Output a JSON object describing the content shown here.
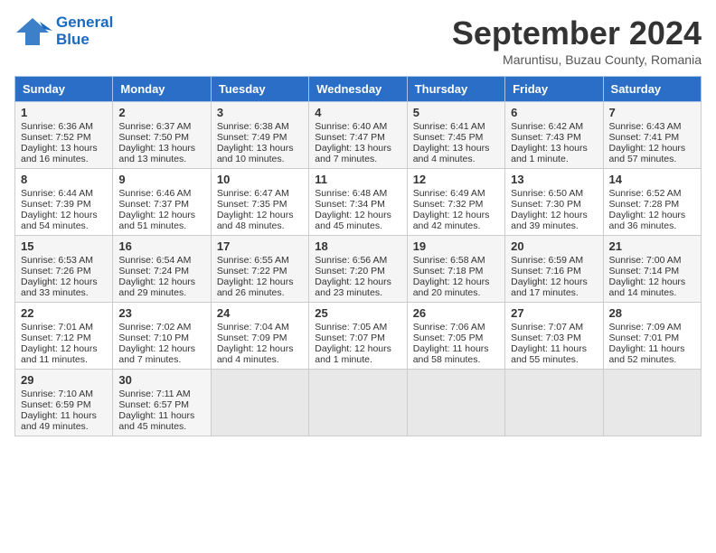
{
  "header": {
    "logo_line1": "General",
    "logo_line2": "Blue",
    "month": "September 2024",
    "location": "Maruntisu, Buzau County, Romania"
  },
  "weekdays": [
    "Sunday",
    "Monday",
    "Tuesday",
    "Wednesday",
    "Thursday",
    "Friday",
    "Saturday"
  ],
  "weeks": [
    [
      {
        "day": "1",
        "lines": [
          "Sunrise: 6:36 AM",
          "Sunset: 7:52 PM",
          "Daylight: 13 hours",
          "and 16 minutes."
        ]
      },
      {
        "day": "2",
        "lines": [
          "Sunrise: 6:37 AM",
          "Sunset: 7:50 PM",
          "Daylight: 13 hours",
          "and 13 minutes."
        ]
      },
      {
        "day": "3",
        "lines": [
          "Sunrise: 6:38 AM",
          "Sunset: 7:49 PM",
          "Daylight: 13 hours",
          "and 10 minutes."
        ]
      },
      {
        "day": "4",
        "lines": [
          "Sunrise: 6:40 AM",
          "Sunset: 7:47 PM",
          "Daylight: 13 hours",
          "and 7 minutes."
        ]
      },
      {
        "day": "5",
        "lines": [
          "Sunrise: 6:41 AM",
          "Sunset: 7:45 PM",
          "Daylight: 13 hours",
          "and 4 minutes."
        ]
      },
      {
        "day": "6",
        "lines": [
          "Sunrise: 6:42 AM",
          "Sunset: 7:43 PM",
          "Daylight: 13 hours",
          "and 1 minute."
        ]
      },
      {
        "day": "7",
        "lines": [
          "Sunrise: 6:43 AM",
          "Sunset: 7:41 PM",
          "Daylight: 12 hours",
          "and 57 minutes."
        ]
      }
    ],
    [
      {
        "day": "8",
        "lines": [
          "Sunrise: 6:44 AM",
          "Sunset: 7:39 PM",
          "Daylight: 12 hours",
          "and 54 minutes."
        ]
      },
      {
        "day": "9",
        "lines": [
          "Sunrise: 6:46 AM",
          "Sunset: 7:37 PM",
          "Daylight: 12 hours",
          "and 51 minutes."
        ]
      },
      {
        "day": "10",
        "lines": [
          "Sunrise: 6:47 AM",
          "Sunset: 7:35 PM",
          "Daylight: 12 hours",
          "and 48 minutes."
        ]
      },
      {
        "day": "11",
        "lines": [
          "Sunrise: 6:48 AM",
          "Sunset: 7:34 PM",
          "Daylight: 12 hours",
          "and 45 minutes."
        ]
      },
      {
        "day": "12",
        "lines": [
          "Sunrise: 6:49 AM",
          "Sunset: 7:32 PM",
          "Daylight: 12 hours",
          "and 42 minutes."
        ]
      },
      {
        "day": "13",
        "lines": [
          "Sunrise: 6:50 AM",
          "Sunset: 7:30 PM",
          "Daylight: 12 hours",
          "and 39 minutes."
        ]
      },
      {
        "day": "14",
        "lines": [
          "Sunrise: 6:52 AM",
          "Sunset: 7:28 PM",
          "Daylight: 12 hours",
          "and 36 minutes."
        ]
      }
    ],
    [
      {
        "day": "15",
        "lines": [
          "Sunrise: 6:53 AM",
          "Sunset: 7:26 PM",
          "Daylight: 12 hours",
          "and 33 minutes."
        ]
      },
      {
        "day": "16",
        "lines": [
          "Sunrise: 6:54 AM",
          "Sunset: 7:24 PM",
          "Daylight: 12 hours",
          "and 29 minutes."
        ]
      },
      {
        "day": "17",
        "lines": [
          "Sunrise: 6:55 AM",
          "Sunset: 7:22 PM",
          "Daylight: 12 hours",
          "and 26 minutes."
        ]
      },
      {
        "day": "18",
        "lines": [
          "Sunrise: 6:56 AM",
          "Sunset: 7:20 PM",
          "Daylight: 12 hours",
          "and 23 minutes."
        ]
      },
      {
        "day": "19",
        "lines": [
          "Sunrise: 6:58 AM",
          "Sunset: 7:18 PM",
          "Daylight: 12 hours",
          "and 20 minutes."
        ]
      },
      {
        "day": "20",
        "lines": [
          "Sunrise: 6:59 AM",
          "Sunset: 7:16 PM",
          "Daylight: 12 hours",
          "and 17 minutes."
        ]
      },
      {
        "day": "21",
        "lines": [
          "Sunrise: 7:00 AM",
          "Sunset: 7:14 PM",
          "Daylight: 12 hours",
          "and 14 minutes."
        ]
      }
    ],
    [
      {
        "day": "22",
        "lines": [
          "Sunrise: 7:01 AM",
          "Sunset: 7:12 PM",
          "Daylight: 12 hours",
          "and 11 minutes."
        ]
      },
      {
        "day": "23",
        "lines": [
          "Sunrise: 7:02 AM",
          "Sunset: 7:10 PM",
          "Daylight: 12 hours",
          "and 7 minutes."
        ]
      },
      {
        "day": "24",
        "lines": [
          "Sunrise: 7:04 AM",
          "Sunset: 7:09 PM",
          "Daylight: 12 hours",
          "and 4 minutes."
        ]
      },
      {
        "day": "25",
        "lines": [
          "Sunrise: 7:05 AM",
          "Sunset: 7:07 PM",
          "Daylight: 12 hours",
          "and 1 minute."
        ]
      },
      {
        "day": "26",
        "lines": [
          "Sunrise: 7:06 AM",
          "Sunset: 7:05 PM",
          "Daylight: 11 hours",
          "and 58 minutes."
        ]
      },
      {
        "day": "27",
        "lines": [
          "Sunrise: 7:07 AM",
          "Sunset: 7:03 PM",
          "Daylight: 11 hours",
          "and 55 minutes."
        ]
      },
      {
        "day": "28",
        "lines": [
          "Sunrise: 7:09 AM",
          "Sunset: 7:01 PM",
          "Daylight: 11 hours",
          "and 52 minutes."
        ]
      }
    ],
    [
      {
        "day": "29",
        "lines": [
          "Sunrise: 7:10 AM",
          "Sunset: 6:59 PM",
          "Daylight: 11 hours",
          "and 49 minutes."
        ]
      },
      {
        "day": "30",
        "lines": [
          "Sunrise: 7:11 AM",
          "Sunset: 6:57 PM",
          "Daylight: 11 hours",
          "and 45 minutes."
        ]
      },
      {
        "day": "",
        "lines": []
      },
      {
        "day": "",
        "lines": []
      },
      {
        "day": "",
        "lines": []
      },
      {
        "day": "",
        "lines": []
      },
      {
        "day": "",
        "lines": []
      }
    ]
  ]
}
